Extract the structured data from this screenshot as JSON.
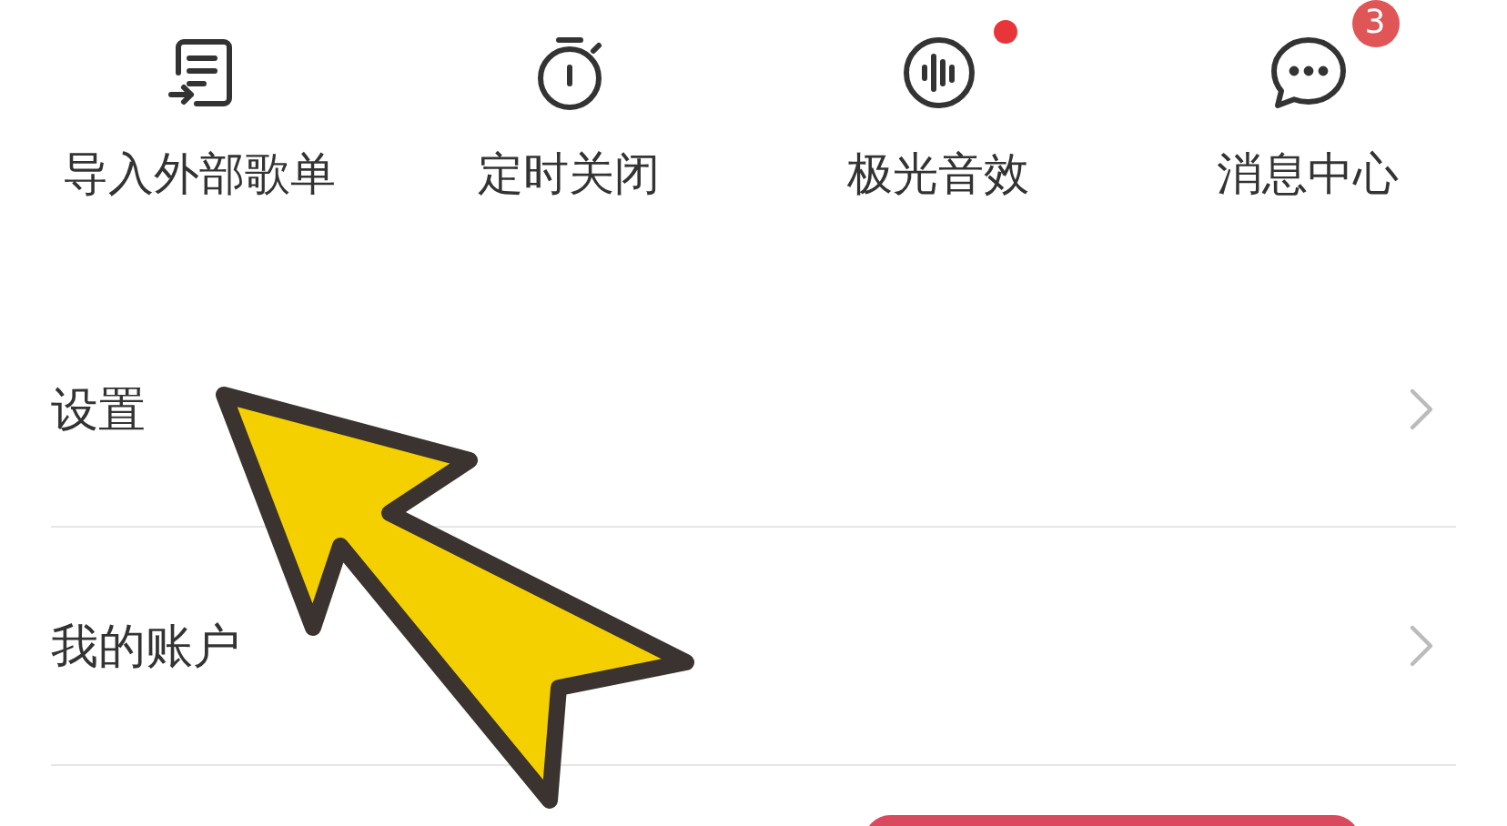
{
  "shortcuts": [
    {
      "label": "导入外部歌单",
      "kind": "import-list"
    },
    {
      "label": "定时关闭",
      "kind": "timer"
    },
    {
      "label": "极光音效",
      "kind": "sound-wave",
      "badge": {
        "kind": "dot"
      }
    },
    {
      "label": "消息中心",
      "kind": "chat",
      "badge": {
        "kind": "count",
        "text": "3"
      }
    }
  ],
  "menu": [
    {
      "label": "设置"
    },
    {
      "label": "我的账户"
    }
  ]
}
